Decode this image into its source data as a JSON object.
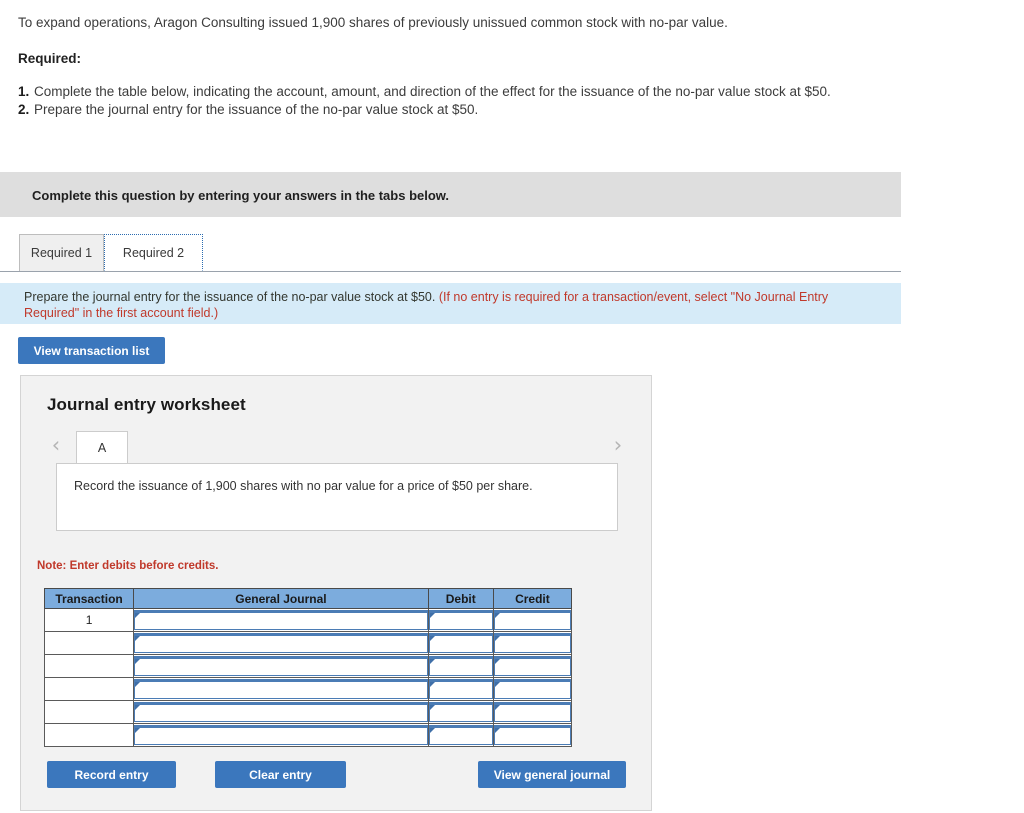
{
  "problem": {
    "statement": "To expand operations, Aragon Consulting issued 1,900 shares of previously unissued common stock with no-par value.",
    "required_label": "Required:",
    "requirements": [
      {
        "num": "1.",
        "text": "Complete the table below, indicating the account, amount, and direction of the effect for the issuance of the no-par value stock at $50."
      },
      {
        "num": "2.",
        "text": "Prepare the journal entry for the issuance of the no-par value stock at $50."
      }
    ]
  },
  "banner": {
    "text": "Complete this question by entering your answers in the tabs below."
  },
  "tabs": [
    {
      "label": "Required 1",
      "active": false
    },
    {
      "label": "Required 2",
      "active": true
    }
  ],
  "instruction": {
    "main": "Prepare the journal entry for the issuance of the no-par value stock at $50. ",
    "hint": "(If no entry is required for a transaction/event, select \"No Journal Entry Required\" in the first account field.)"
  },
  "toolbar": {
    "view_transaction_list_label": "View transaction list"
  },
  "worksheet": {
    "title": "Journal entry worksheet",
    "prev_icon": "chevron-left-icon",
    "next_icon": "chevron-right-icon",
    "entry_tabs": [
      {
        "label": "A",
        "active": true
      }
    ],
    "description": "Record the issuance of 1,900 shares with no par value for a price of $50 per share.",
    "note": "Note: Enter debits before credits."
  },
  "journal_table": {
    "headers": [
      "Transaction",
      "General Journal",
      "Debit",
      "Credit"
    ],
    "rows": [
      {
        "transaction": "1",
        "general_journal": "",
        "debit": "",
        "credit": ""
      },
      {
        "transaction": "",
        "general_journal": "",
        "debit": "",
        "credit": ""
      },
      {
        "transaction": "",
        "general_journal": "",
        "debit": "",
        "credit": ""
      },
      {
        "transaction": "",
        "general_journal": "",
        "debit": "",
        "credit": ""
      },
      {
        "transaction": "",
        "general_journal": "",
        "debit": "",
        "credit": ""
      },
      {
        "transaction": "",
        "general_journal": "",
        "debit": "",
        "credit": ""
      }
    ]
  },
  "footer": {
    "record_entry_label": "Record entry",
    "clear_entry_label": "Clear entry",
    "view_general_journal_label": "View general journal"
  },
  "colors": {
    "button_blue": "#3b77bd",
    "table_header_blue": "#7cacdd",
    "instruction_bar_blue": "#d6ebf8",
    "banner_gray": "#dedede",
    "panel_gray": "#f2f2f2",
    "alert_red": "#c0392b"
  }
}
